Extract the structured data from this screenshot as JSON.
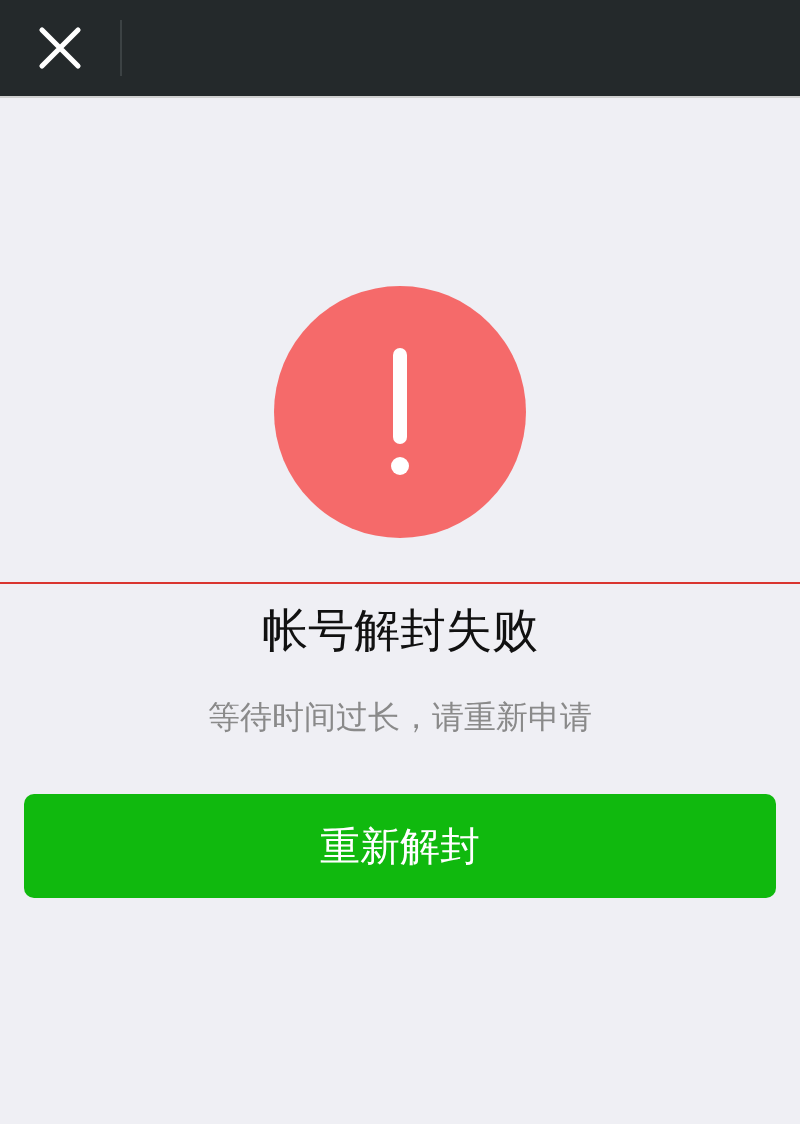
{
  "title": "帐号解封失败",
  "message": "等待时间过长，请重新申请",
  "button": {
    "label": "重新解封"
  }
}
